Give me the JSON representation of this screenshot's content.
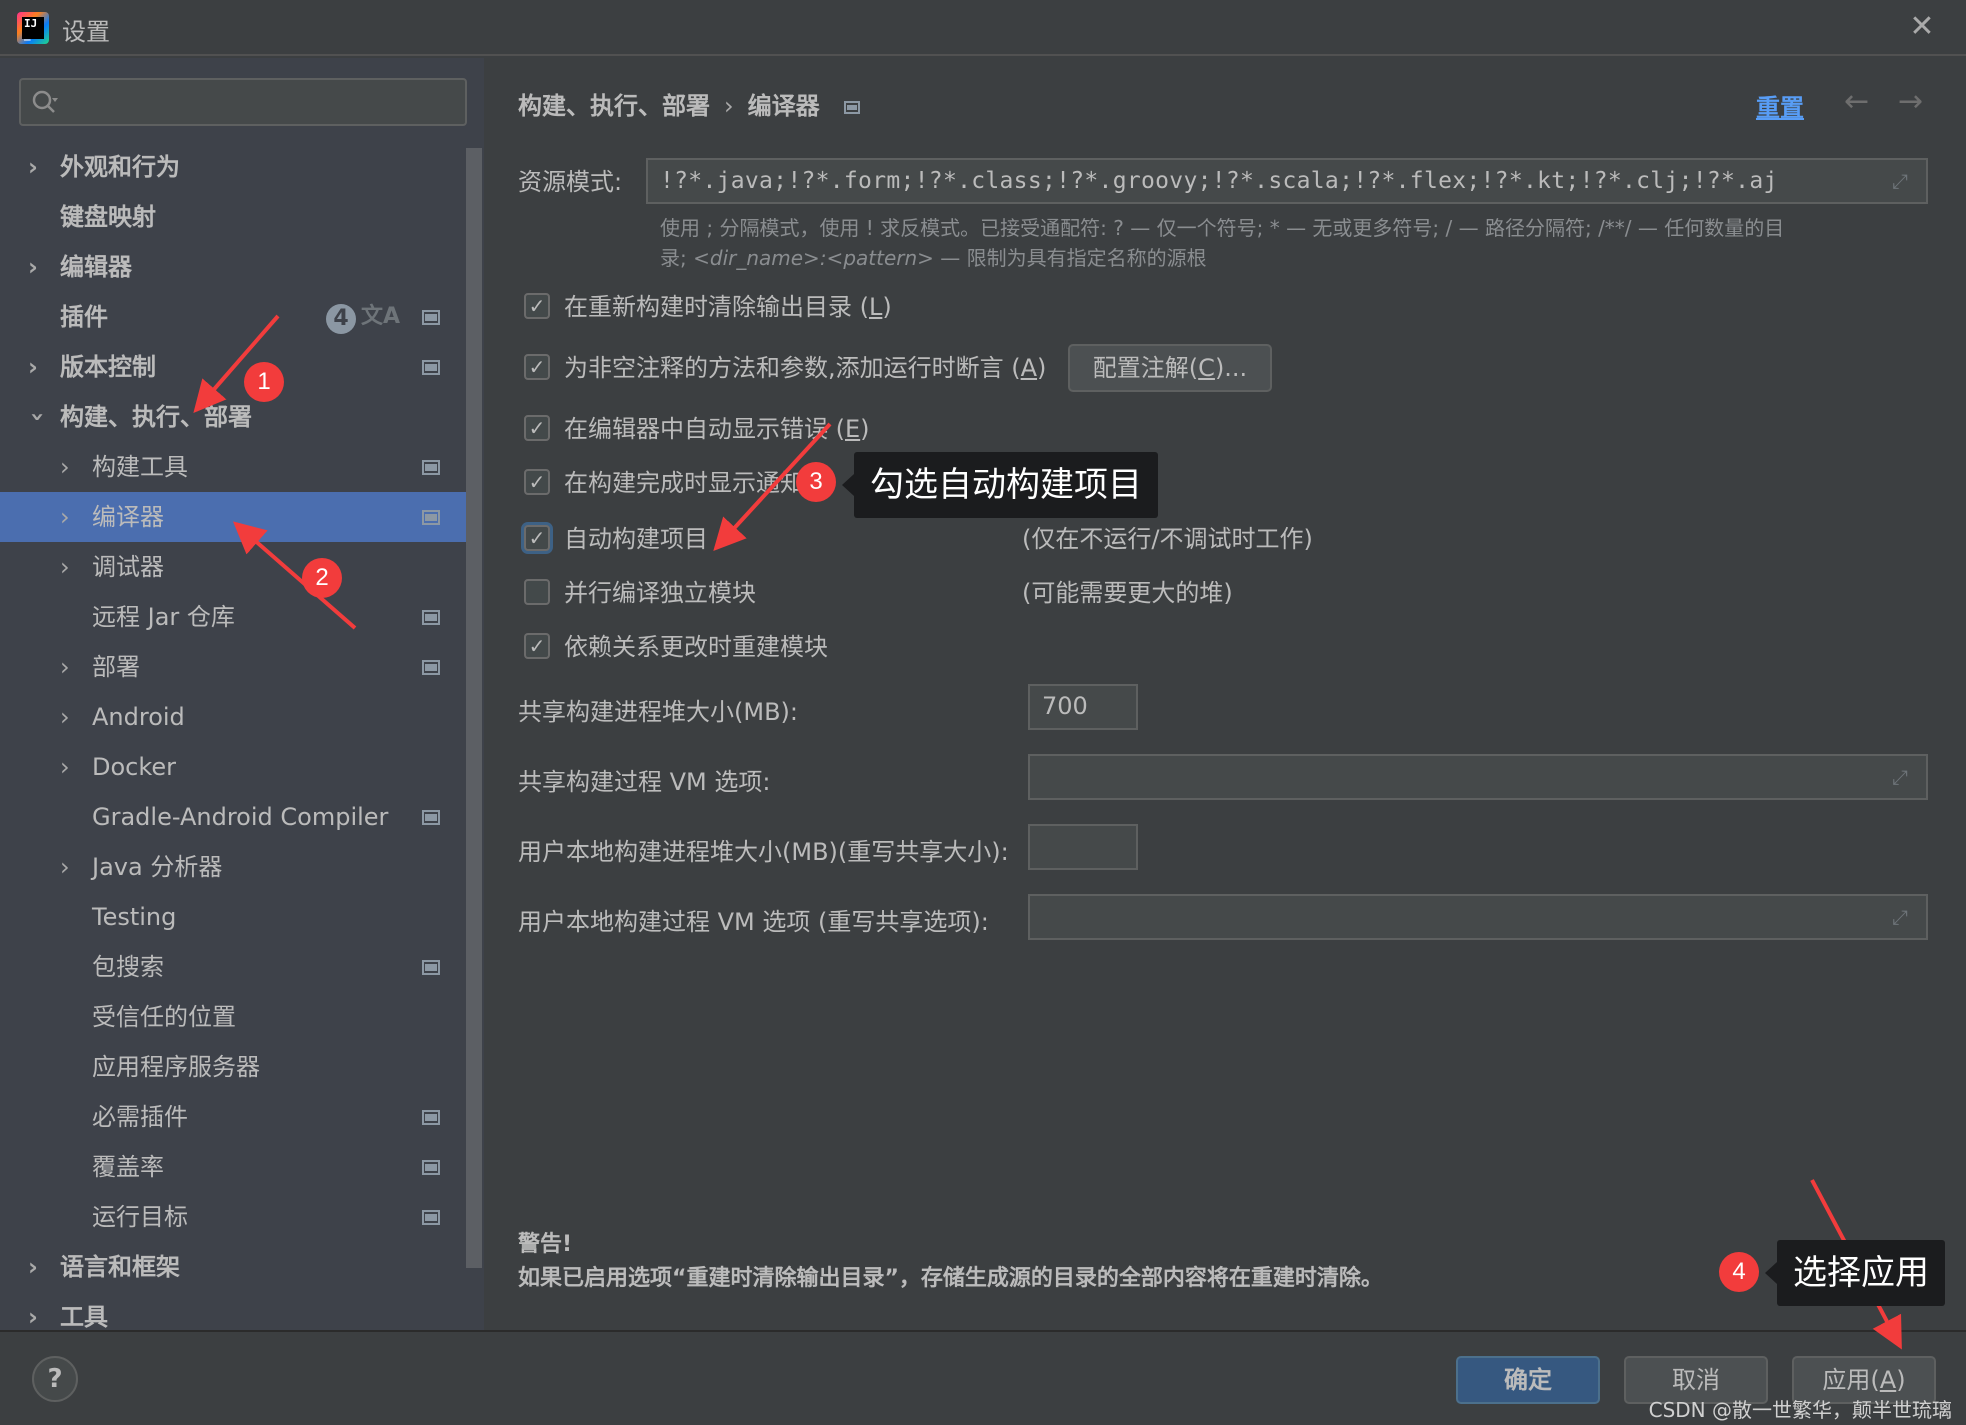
{
  "window": {
    "title": "设置",
    "app_icon": "intellij-idea-logo",
    "close_icon": "close-icon"
  },
  "sidebar": {
    "search": {
      "value": "",
      "placeholder": "",
      "icon": "search-icon"
    },
    "items": [
      {
        "label": "外观和行为",
        "level": 0,
        "bold": true,
        "expandable": true,
        "expanded": false
      },
      {
        "label": "键盘映射",
        "level": 0,
        "bold": true,
        "expandable": false
      },
      {
        "label": "编辑器",
        "level": 0,
        "bold": true,
        "expandable": true,
        "expanded": false
      },
      {
        "label": "插件",
        "level": 0,
        "bold": true,
        "expandable": false,
        "badge": "4",
        "translate_icon": "文A",
        "project_icon": true
      },
      {
        "label": "版本控制",
        "level": 0,
        "bold": true,
        "expandable": true,
        "expanded": false,
        "project_icon": true
      },
      {
        "label": "构建、执行、部署",
        "level": 0,
        "bold": true,
        "expandable": true,
        "expanded": true
      },
      {
        "label": "构建工具",
        "level": 1,
        "expandable": true,
        "expanded": false,
        "project_icon": true
      },
      {
        "label": "编译器",
        "level": 1,
        "expandable": true,
        "expanded": false,
        "project_icon": true,
        "selected": true
      },
      {
        "label": "调试器",
        "level": 1,
        "expandable": true,
        "expanded": false
      },
      {
        "label": "远程 Jar 仓库",
        "level": 1,
        "expandable": false,
        "project_icon": true
      },
      {
        "label": "部署",
        "level": 1,
        "expandable": true,
        "expanded": false,
        "project_icon": true
      },
      {
        "label": "Android",
        "level": 1,
        "expandable": true,
        "expanded": false
      },
      {
        "label": "Docker",
        "level": 1,
        "expandable": true,
        "expanded": false
      },
      {
        "label": "Gradle-Android Compiler",
        "level": 1,
        "expandable": false,
        "project_icon": true
      },
      {
        "label": "Java 分析器",
        "level": 1,
        "expandable": true,
        "expanded": false
      },
      {
        "label": "Testing",
        "level": 1,
        "expandable": false
      },
      {
        "label": "包搜索",
        "level": 1,
        "expandable": false,
        "project_icon": true
      },
      {
        "label": "受信任的位置",
        "level": 1,
        "expandable": false
      },
      {
        "label": "应用程序服务器",
        "level": 1,
        "expandable": false
      },
      {
        "label": "必需插件",
        "level": 1,
        "expandable": false,
        "project_icon": true
      },
      {
        "label": "覆盖率",
        "level": 1,
        "expandable": false,
        "project_icon": true
      },
      {
        "label": "运行目标",
        "level": 1,
        "expandable": false,
        "project_icon": true
      },
      {
        "label": "语言和框架",
        "level": 0,
        "bold": true,
        "expandable": true,
        "expanded": false
      },
      {
        "label": "工具",
        "level": 0,
        "bold": true,
        "expandable": true,
        "expanded": false
      }
    ]
  },
  "main": {
    "breadcrumb": {
      "parent": "构建、执行、部署",
      "separator": "›",
      "current": "编译器"
    },
    "reset_label": "重置",
    "nav_back": "←",
    "nav_forward": "→",
    "resource_patterns": {
      "label": "资源模式:",
      "value": "!?*.java;!?*.form;!?*.class;!?*.groovy;!?*.scala;!?*.flex;!?*.kt;!?*.clj;!?*.aj"
    },
    "hint": {
      "line1": "使用 ; 分隔模式，使用 ! 求反模式。已接受通配符: ? — 仅一个符号; * — 无或更多符号; / — 路径分隔符; /**/ — 任何数量的目",
      "line2_prefix": "录; ",
      "line2_italic": "<dir_name>:<pattern>",
      "line2_suffix": " — 限制为具有指定名称的源根"
    },
    "checkboxes": [
      {
        "label": "在重新构建时清除输出目录 (",
        "mnemonic": "L",
        "suffix": ")",
        "checked": true
      },
      {
        "label": "为非空注释的方法和参数,添加运行时断言 (",
        "mnemonic": "A",
        "suffix": ")",
        "checked": true
      },
      {
        "label": "在编辑器中自动显示错误 (",
        "mnemonic": "E",
        "suffix": ")",
        "checked": true
      },
      {
        "label": "在构建完成时显示通知",
        "mnemonic": "",
        "suffix": "",
        "checked": true
      },
      {
        "label": "自动构建项目",
        "mnemonic": "",
        "suffix": "",
        "checked": true,
        "focused": true,
        "note": "(仅在不运行/不调试时工作)"
      },
      {
        "label": "并行编译独立模块",
        "mnemonic": "",
        "suffix": "",
        "checked": false,
        "note": "(可能需要更大的堆)"
      },
      {
        "label": "依赖关系更改时重建模块",
        "mnemonic": "",
        "suffix": "",
        "checked": true
      }
    ],
    "configure_annotations": {
      "label": "配置注解(",
      "mnemonic": "C",
      "suffix": ")..."
    },
    "heap_size": {
      "label": "共享构建进程堆大小(MB):",
      "value": "700"
    },
    "vm_options": {
      "label": "共享构建过程 VM 选项:",
      "value": ""
    },
    "user_heap_size": {
      "label": "用户本地构建进程堆大小(MB)(重写共享大小):",
      "value": ""
    },
    "user_vm_options": {
      "label": "用户本地构建过程 VM 选项 (重写共享选项):",
      "value": ""
    },
    "warning": {
      "title": "警告!",
      "text": "如果已启用选项“重建时清除输出目录”，存储生成源的目录的全部内容将在重建时清除。"
    }
  },
  "footer": {
    "help_label": "?",
    "ok_label": "确定",
    "cancel_label": "取消",
    "apply_label": "应用(",
    "apply_mnemonic": "A",
    "apply_suffix": ")",
    "watermark": "CSDN @散一世繁华，颠半世琉璃"
  },
  "annotations": {
    "step1": "1",
    "step2": "2",
    "step3": "3",
    "step3_callout": "勾选自动构建项目",
    "step4": "4",
    "step4_callout": "选择应用",
    "color": "#f23c3c"
  },
  "colors": {
    "selection": "#4b6eaf",
    "link": "#589df6",
    "primary_button": "#365880",
    "background": "#3c3f41",
    "sidebar_background": "#3e424a"
  }
}
